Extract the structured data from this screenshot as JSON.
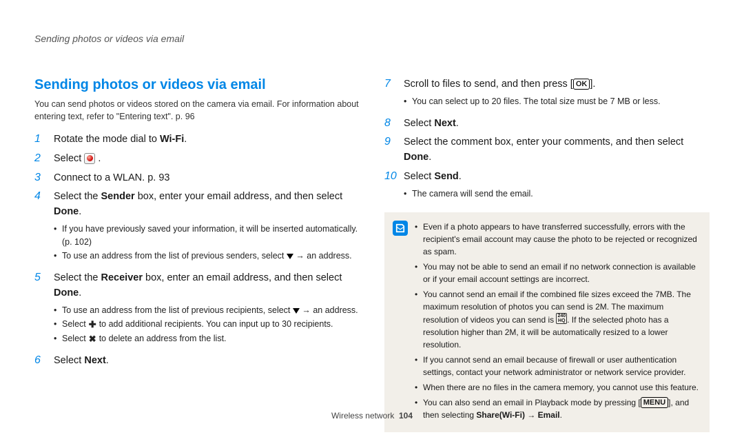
{
  "header": "Sending photos or videos via email",
  "title": "Sending photos or videos via email",
  "intro": "You can send photos or videos stored on the camera via email. For information about entering text, refer to \"Entering text\". p. 96",
  "steps": {
    "s1_a": "Rotate the mode dial to ",
    "s1_wifi": "Wi-Fi",
    "s1_b": ".",
    "s2_a": "Select ",
    "s2_b": " .",
    "s3": "Connect to a WLAN. p. 93",
    "s4_a": "Select the ",
    "s4_sender": "Sender",
    "s4_b": " box, enter your email address, and then select ",
    "s4_done": "Done",
    "s4_c": ".",
    "s4_sub1": "If you have previously saved your information, it will be inserted automatically. (p. 102)",
    "s4_sub2_a": "To use an address from the list of previous senders, select ",
    "s4_sub2_b": " → an address.",
    "s5_a": "Select the ",
    "s5_receiver": "Receiver",
    "s5_b": " box, enter an email address, and then select ",
    "s5_done": "Done",
    "s5_c": ".",
    "s5_sub1_a": "To use an address from the list of previous recipients, select ",
    "s5_sub1_b": " → an address.",
    "s5_sub2_a": "Select ",
    "s5_sub2_b": " to add additional recipients. You can input up to 30 recipients.",
    "s5_sub3_a": "Select ",
    "s5_sub3_b": " to delete an address from the list.",
    "s6_a": "Select ",
    "s6_next": "Next",
    "s6_b": ".",
    "s7_a": "Scroll to files to send, and then press [",
    "s7_ok": "OK",
    "s7_b": "].",
    "s7_sub1": "You can select up to 20 files. The total size must be 7 MB or less.",
    "s8_a": "Select ",
    "s8_next": "Next",
    "s8_b": ".",
    "s9_a": "Select the comment box, enter your comments, and then select ",
    "s9_done": "Done",
    "s9_b": ".",
    "s10_a": "Select ",
    "s10_send": "Send",
    "s10_b": ".",
    "s10_sub1": "The camera will send the email."
  },
  "notes": {
    "n1": "Even if a photo appears to have transferred successfully, errors with the recipient's email account may cause the photo to be rejected or recognized as spam.",
    "n2": "You may not be able to send an email if no network connection is available or if your email account settings are incorrect.",
    "n3_a": "You cannot send an email if the combined file sizes exceed the 7MB. The maximum resolution of photos you can send is 2M. The maximum resolution of videos you can send is ",
    "n3_res": "240\nHQ",
    "n3_b": ". If the selected photo has a resolution higher than 2M, it will be automatically resized to a lower resolution.",
    "n4": "If you cannot send an email because of firewall or user authentication settings, contact your network administrator or network service provider.",
    "n5": "When there are no files in the camera memory, you cannot use this feature.",
    "n6_a": "You can also send an email in Playback mode by pressing [",
    "n6_menu": "MENU",
    "n6_b": "], and then selecting ",
    "n6_path": "Share(Wi-Fi) → Email",
    "n6_c": "."
  },
  "footer": {
    "section": "Wireless network",
    "page": "104"
  }
}
